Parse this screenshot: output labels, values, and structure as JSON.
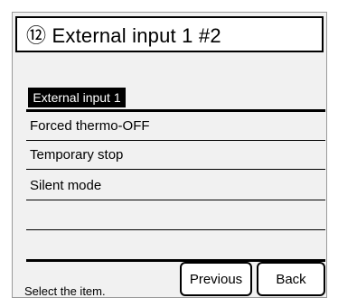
{
  "title": "⑫ External input 1 #2",
  "list_header": "External input 1",
  "items": [
    {
      "label": "Forced thermo-OFF"
    },
    {
      "label": "Temporary stop"
    },
    {
      "label": "Silent mode"
    },
    {
      "label": ""
    },
    {
      "label": ""
    }
  ],
  "status": "Select the item.",
  "buttons": {
    "previous": "Previous",
    "back": "Back"
  }
}
